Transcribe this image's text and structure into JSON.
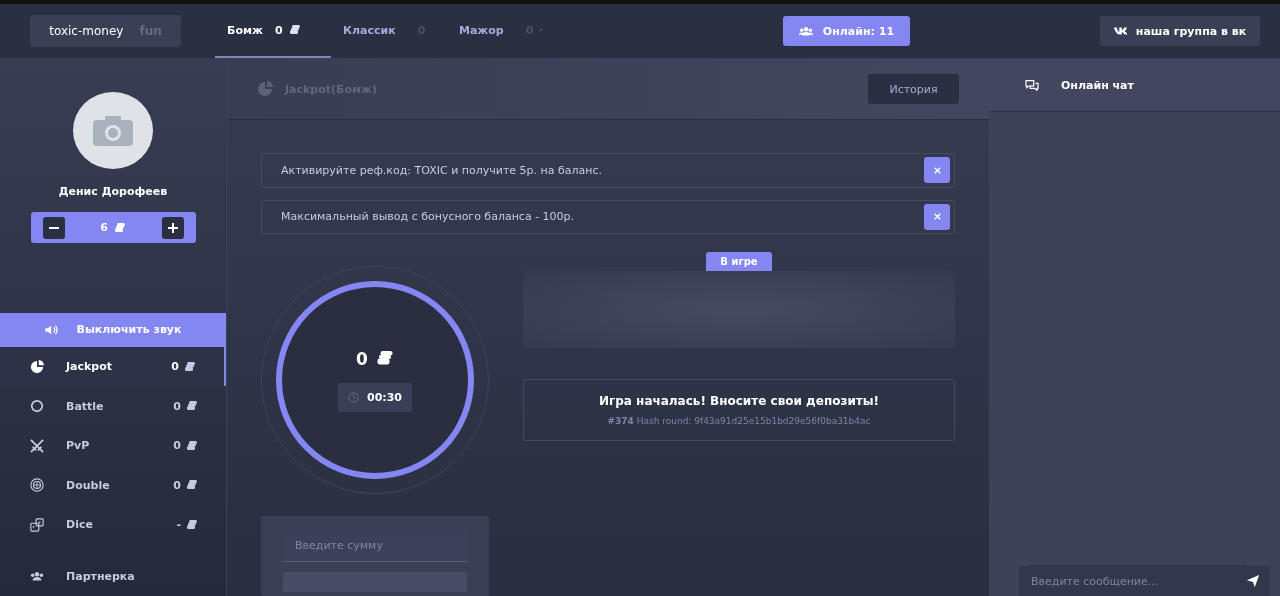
{
  "brand": {
    "name": "toxic-money",
    "tag": "fun"
  },
  "rooms": [
    {
      "label": "Бомж",
      "amount": "0",
      "selected": true
    },
    {
      "label": "Классик",
      "amount": "0",
      "selected": false
    },
    {
      "label": "Мажор",
      "amount": "0",
      "selected": false
    }
  ],
  "online": {
    "label": "Онлайн: 11"
  },
  "vk_button": {
    "label": "наша группа в вк"
  },
  "profile": {
    "name": "Денис Дорофеев",
    "balance": "6"
  },
  "sound_button": {
    "label": "Выключить звук"
  },
  "games": [
    {
      "kind": "jackpot",
      "label": "Jackpot",
      "amount": "0",
      "selected": true
    },
    {
      "kind": "battle",
      "label": "Battle",
      "amount": "0",
      "selected": false
    },
    {
      "kind": "pvp",
      "label": "PvP",
      "amount": "0",
      "selected": false
    },
    {
      "kind": "double",
      "label": "Double",
      "amount": "0",
      "selected": false
    },
    {
      "kind": "dice",
      "label": "Dice",
      "amount": "-",
      "selected": false
    }
  ],
  "partner": {
    "label": "Партнерка"
  },
  "game_header": {
    "title": "Jackpot(Бомж)",
    "history_button": "История"
  },
  "notices": [
    {
      "text": "Активируйте реф.код: TOXIC и получите 5р. на баланс."
    },
    {
      "text": "Максимальный вывод с бонусного баланса - 100р."
    }
  ],
  "wheel": {
    "amount": "0",
    "timer": "00:30"
  },
  "players_tab": "В игре",
  "status": {
    "message": "Игра началась! Вносите свои депозиты!",
    "hash": "**#374** Hash round: 9f43a91d25e15b1bd29e56f0ba31b4ac"
  },
  "bet": {
    "placeholder": "Введите сумму"
  },
  "chat": {
    "title": "Онлайн чат",
    "placeholder": "Введите сообщение..."
  }
}
